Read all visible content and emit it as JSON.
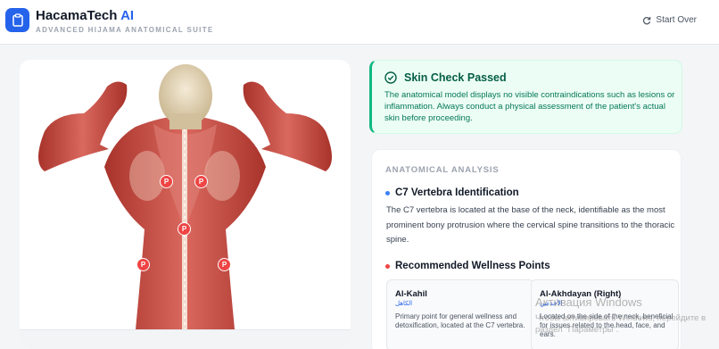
{
  "header": {
    "brand_name": "HacamaTech",
    "brand_accent": "AI",
    "subtitle": "ADVANCED HIJAMA ANATOMICAL SUITE",
    "start_over_label": "Start Over",
    "logo_icon": "clipboard-icon",
    "accent_color": "#2563eb"
  },
  "figure": {
    "marker_label": "P",
    "marker_color": "#ef4444"
  },
  "skin_check": {
    "title": "Skin Check Passed",
    "text": "The anatomical model displays no visible contraindications such as lesions or inflammation. Always conduct a physical assessment of the patient's actual skin before proceeding.",
    "icon": "check-circle-icon",
    "color": "#10b981"
  },
  "analysis": {
    "section_label": "ANATOMICAL ANALYSIS",
    "c7_title": "C7 Vertebra Identification",
    "c7_text": "The C7 vertebra is located at the base of the neck, identifiable as the most prominent bony protrusion where the cervical spine transitions to the thoracic spine.",
    "recommended_title": "Recommended Wellness Points",
    "points": [
      {
        "name": "Al-Kahil",
        "arabic": "الكاهل",
        "desc": "Primary point for general wellness and detoxification, located at the C7 vertebra."
      },
      {
        "name": "Al-Akhdayan (Right)",
        "arabic": "الأخدعين",
        "desc": "Located on the side of the neck, beneficial for issues related to the head, face, and ears."
      }
    ]
  },
  "watermark": {
    "line1": "Активация Windows",
    "line2": "Чтобы активировать Windows, перейдите в раздел \"Параметры\"."
  }
}
